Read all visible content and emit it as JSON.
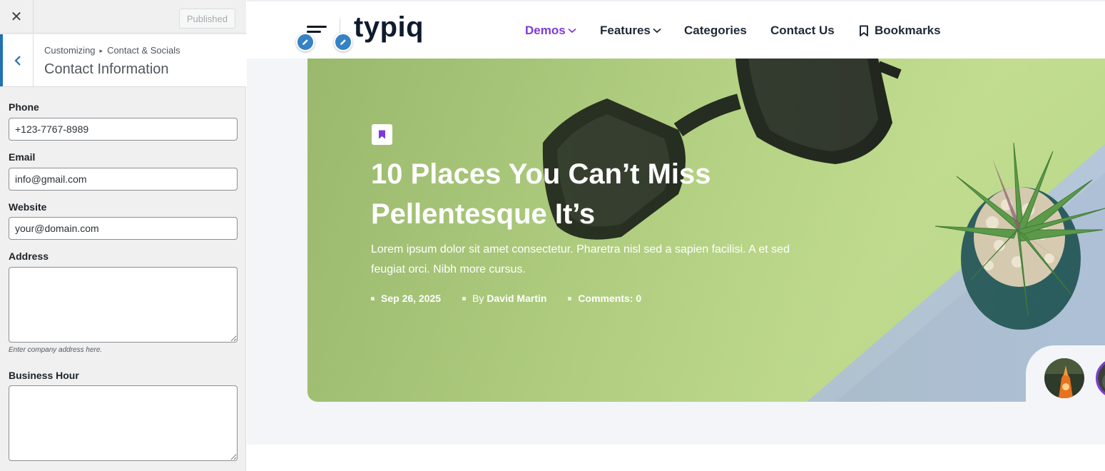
{
  "panel": {
    "close_symbol": "✕",
    "publish_label": "Published",
    "back_symbol": "‹",
    "breadcrumb_root": "Customizing",
    "breadcrumb_separator": "▸",
    "breadcrumb_section": "Contact & Socials",
    "section_title": "Contact Information",
    "fields": {
      "phone": {
        "label": "Phone",
        "value": "+123-7767-8989"
      },
      "email": {
        "label": "Email",
        "value": "info@gmail.com"
      },
      "website": {
        "label": "Website",
        "value": "your@domain.com"
      },
      "address": {
        "label": "Address",
        "value": "",
        "description": "Enter company address here."
      },
      "business_hour": {
        "label": "Business Hour",
        "value": ""
      }
    }
  },
  "site": {
    "logo_text": "typiq",
    "nav": [
      {
        "label": "Demos",
        "has_dropdown": true,
        "active": true
      },
      {
        "label": "Features",
        "has_dropdown": true,
        "active": false
      },
      {
        "label": "Categories",
        "has_dropdown": false,
        "active": false
      },
      {
        "label": "Contact Us",
        "has_dropdown": false,
        "active": false
      },
      {
        "label": "Bookmarks",
        "icon": "bookmark-icon",
        "active": false
      }
    ],
    "hero": {
      "title": "10 Places You Can’t Miss Pellentesque It’s",
      "excerpt": "Lorem ipsum dolor sit amet consectetur. Pharetra nisl sed a sapien facilisi. A et sed feugiat orci. Nibh more cursus.",
      "date": "Sep 26, 2025",
      "author_prefix": "By",
      "author": "David Martin",
      "comments": "Comments: 0"
    }
  },
  "colors": {
    "accent": "#7e3ad6",
    "wp_blue": "#2271b1",
    "hero_green": "#b7d586"
  }
}
